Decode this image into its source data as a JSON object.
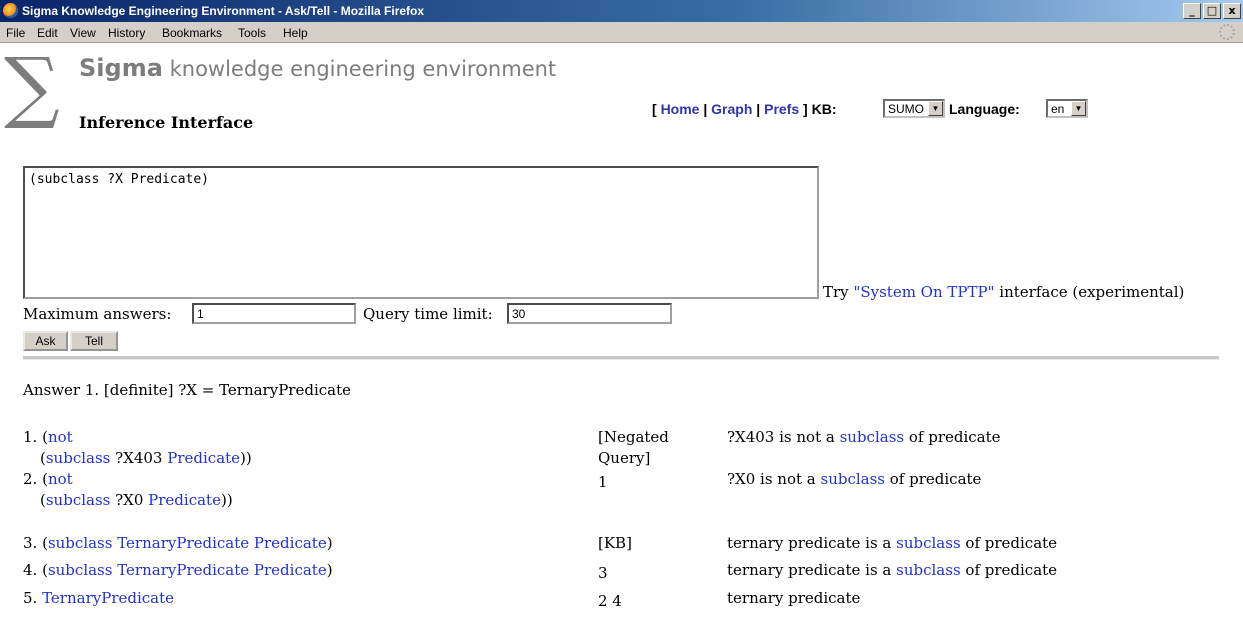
{
  "window": {
    "title": "Sigma Knowledge Engineering Environment - Ask/Tell - Mozilla Firefox",
    "buttons": [
      "_",
      "□",
      "x"
    ]
  },
  "menubar": {
    "items": [
      "File",
      "Edit",
      "View",
      "History",
      "Bookmarks",
      "Tools",
      "Help"
    ]
  },
  "header": {
    "logo_symbol": "∑",
    "brand_name": "Sigma",
    "brand_rest": "knowledge engineering environment",
    "subtitle": "Inference Interface"
  },
  "nav": {
    "open_bracket": "[",
    "home": "Home",
    "sep1": "|",
    "graph": "Graph",
    "sep2": "|",
    "prefs": "Prefs",
    "close_bracket": "]",
    "kb_label": "KB:",
    "kb_value": "SUMO",
    "language_label": "Language:",
    "language_value": "en"
  },
  "query": {
    "text": "(subclass ?X Predicate)",
    "try_prefix": "Try",
    "try_link": "\"System On TPTP\"",
    "try_suffix": "interface (experimental)",
    "max_answers_label": "Maximum answers:",
    "max_answers_value": "1",
    "time_limit_label": "Query time limit:",
    "time_limit_value": "30",
    "ask_label": "Ask",
    "tell_label": "Tell"
  },
  "answer": {
    "header": "Answer 1. [definite] ?X = TernaryPredicate"
  },
  "proof": [
    {
      "num": "1.",
      "line1_open": "(",
      "line1_link": "not",
      "line2_open": "(",
      "line2_link": "subclass",
      "line2_mid": " ?X403 ",
      "line2_link2": "Predicate",
      "line2_close": "))",
      "source": "[Negated Query]",
      "para_pre": "?X403 is not a ",
      "para_link": "subclass",
      "para_post": " of predicate"
    },
    {
      "num": "2.",
      "line1_open": "(",
      "line1_link": "not",
      "line2_open": "(",
      "line2_link": "subclass",
      "line2_mid": " ?X0 ",
      "line2_link2": "Predicate",
      "line2_close": "))",
      "source": "1",
      "para_pre": "?X0 is not a ",
      "para_link": "subclass",
      "para_post": " of predicate"
    },
    {
      "num": "3.",
      "line1_open": "(",
      "line1_link": "subclass TernaryPredicate Predicate",
      "line1_close": ")",
      "source": "[KB]",
      "para_pre": "ternary predicate is a ",
      "para_link": "subclass",
      "para_post": " of predicate"
    },
    {
      "num": "4.",
      "line1_open": "(",
      "line1_link": "subclass TernaryPredicate Predicate",
      "line1_close": ")",
      "source": "3",
      "para_pre": "ternary predicate is a ",
      "para_link": "subclass",
      "para_post": " of predicate"
    },
    {
      "num": "5.",
      "line1_link": "TernaryPredicate",
      "source": "2 4",
      "para_pre": "ternary predicate"
    }
  ],
  "colors": {
    "link": "#2233cc",
    "nav_link": "#3333aa",
    "logo_gray": "#7d7d7d",
    "titlebar": "#0a246a"
  }
}
